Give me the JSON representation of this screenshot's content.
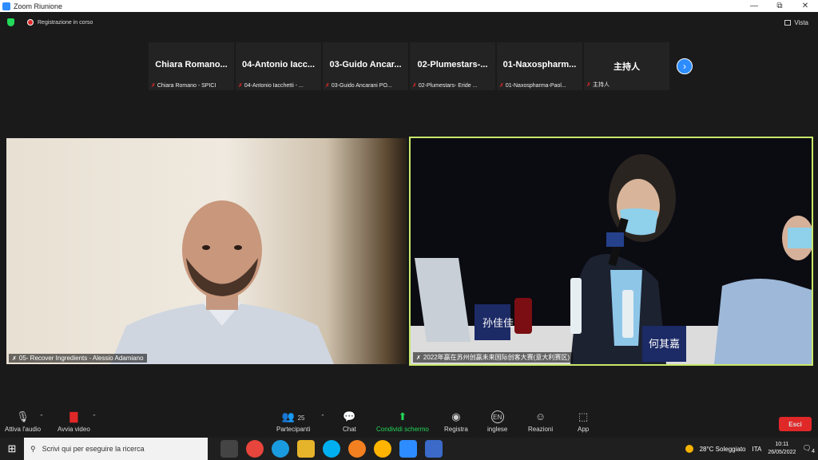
{
  "window": {
    "title": "Zoom Riunione",
    "minimize": "—",
    "maximize": "⧉",
    "close": "✕"
  },
  "meeting": {
    "recording_label": "Registrazione in corso",
    "view_label": "Vista"
  },
  "thumbnails": [
    {
      "name": "Chiara Romano...",
      "label": "Chiara Romano - SPICI"
    },
    {
      "name": "04-Antonio Iacc...",
      "label": "04-Antonio Iacchetti - ..."
    },
    {
      "name": "03-Guido Ancar...",
      "label": "03-Guido Ancarani PO..."
    },
    {
      "name": "02-Plumestars-...",
      "label": "02-Plumestars- Eride ..."
    },
    {
      "name": "01-Naxospharm...",
      "label": "01-Naxospharma-Paol..."
    },
    {
      "name": "主持人",
      "label": "主持人"
    }
  ],
  "videos": {
    "left_label": "05- Recover Ingredients - Alessio Adamiano",
    "right_label": "2022年赢在苏州创赢未来国际创客大赛(意大利赛区)",
    "name_card_1": "孙佳佳",
    "name_card_2": "何其嘉"
  },
  "toolbar": {
    "audio": "Attiva l'audio",
    "video": "Avvia video",
    "participants": "Partecipanti",
    "participants_count": "25",
    "chat": "Chat",
    "share": "Condividi schermo",
    "record": "Registra",
    "lang_badge": "EN",
    "language": "inglese",
    "reactions": "Reazioni",
    "apps": "App",
    "leave": "Esci"
  },
  "taskbar": {
    "search_placeholder": "Scrivi qui per eseguire la ricerca",
    "weather": "28°C Soleggiato",
    "lang": "ITA",
    "time": "10:11",
    "date": "26/05/2022",
    "notification_count": "4"
  },
  "colors": {
    "accent": "#2d8cff",
    "active_speaker": "#c8e86a",
    "leave": "#e02828",
    "share": "#23d959"
  }
}
